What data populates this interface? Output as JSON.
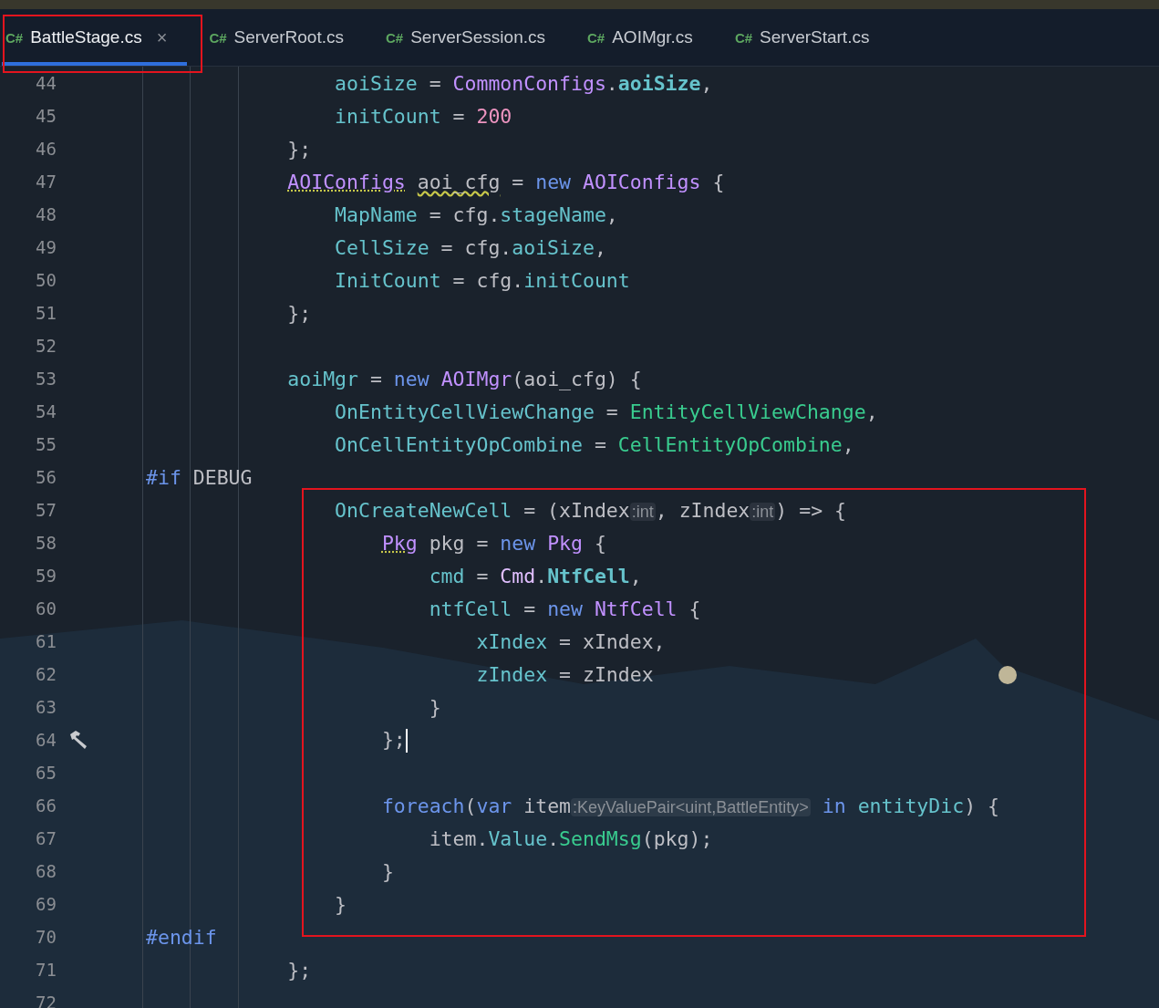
{
  "tabs": [
    {
      "icon": "C#",
      "label": "BattleStage.cs",
      "selected": true,
      "close": "×"
    },
    {
      "icon": "C#",
      "label": "ServerRoot.cs",
      "selected": false
    },
    {
      "icon": "C#",
      "label": "ServerSession.cs",
      "selected": false
    },
    {
      "icon": "C#",
      "label": "AOIMgr.cs",
      "selected": false
    },
    {
      "icon": "C#",
      "label": "ServerStart.cs",
      "selected": false
    }
  ],
  "editor": {
    "lines": [
      {
        "number": "44",
        "tokens": [
          {
            "t": "                aoiSize",
            "kind": "field"
          },
          {
            "t": " = ",
            "kind": "plain"
          },
          {
            "t": "CommonConfigs",
            "kind": "type"
          },
          {
            "t": ".",
            "kind": "plain"
          },
          {
            "t": "aoiSize",
            "kind": "static"
          },
          {
            "t": ",",
            "kind": "plain"
          }
        ]
      },
      {
        "number": "45",
        "tokens": [
          {
            "t": "                initCount",
            "kind": "field"
          },
          {
            "t": " = ",
            "kind": "plain"
          },
          {
            "t": "200",
            "kind": "number"
          }
        ]
      },
      {
        "number": "46",
        "tokens": [
          {
            "t": "            };",
            "kind": "plain"
          }
        ]
      },
      {
        "number": "47",
        "tokens": [
          {
            "t": "            AOIConfigs",
            "kind": "type",
            "suggestion": true
          },
          {
            "t": " aoi_cfg",
            "kind": "plain",
            "warning": true
          },
          {
            "t": " = ",
            "kind": "plain"
          },
          {
            "t": "new",
            "kind": "keyword"
          },
          {
            "t": " AOIConfigs",
            "kind": "type"
          },
          {
            "t": " {",
            "kind": "plain"
          }
        ]
      },
      {
        "number": "48",
        "tokens": [
          {
            "t": "                MapName",
            "kind": "field"
          },
          {
            "t": " = cfg.",
            "kind": "plain"
          },
          {
            "t": "stageName",
            "kind": "field"
          },
          {
            "t": ",",
            "kind": "plain"
          }
        ]
      },
      {
        "number": "49",
        "tokens": [
          {
            "t": "                CellSize",
            "kind": "field"
          },
          {
            "t": " = cfg.",
            "kind": "plain"
          },
          {
            "t": "aoiSize",
            "kind": "field"
          },
          {
            "t": ",",
            "kind": "plain"
          }
        ]
      },
      {
        "number": "50",
        "tokens": [
          {
            "t": "                InitCount",
            "kind": "field"
          },
          {
            "t": " = cfg.",
            "kind": "plain"
          },
          {
            "t": "initCount",
            "kind": "field"
          }
        ]
      },
      {
        "number": "51",
        "tokens": [
          {
            "t": "            };",
            "kind": "plain"
          }
        ]
      },
      {
        "number": "52"
      },
      {
        "number": "53",
        "tokens": [
          {
            "t": "            aoiMgr",
            "kind": "field"
          },
          {
            "t": " = ",
            "kind": "plain"
          },
          {
            "t": "new",
            "kind": "keyword"
          },
          {
            "t": " AOIMgr",
            "kind": "type"
          },
          {
            "t": "(aoi_cfg) {",
            "kind": "plain"
          }
        ]
      },
      {
        "number": "54",
        "tokens": [
          {
            "t": "                OnEntityCellViewChange",
            "kind": "field"
          },
          {
            "t": " = ",
            "kind": "plain"
          },
          {
            "t": "EntityCellViewChange",
            "kind": "method"
          },
          {
            "t": ",",
            "kind": "plain"
          }
        ]
      },
      {
        "number": "55",
        "tokens": [
          {
            "t": "                OnCellEntityOpCombine",
            "kind": "field"
          },
          {
            "t": " = ",
            "kind": "plain"
          },
          {
            "t": "CellEntityOpCombine",
            "kind": "method"
          },
          {
            "t": ",",
            "kind": "plain"
          }
        ]
      },
      {
        "number": "56",
        "tokens": [
          {
            "t": "#if",
            "kind": "keyword"
          },
          {
            "t": " DEBUG",
            "kind": "plain"
          }
        ]
      },
      {
        "number": "57",
        "tokens": [
          {
            "t": "                OnCreateNewCell",
            "kind": "field"
          },
          {
            "t": " = (xIndex",
            "kind": "plain"
          },
          {
            "t": ":int",
            "kind": "hint"
          },
          {
            "t": ", zIndex",
            "kind": "plain"
          },
          {
            "t": ":int",
            "kind": "hint"
          },
          {
            "t": ") => {",
            "kind": "plain"
          }
        ]
      },
      {
        "number": "58",
        "tokens": [
          {
            "t": "                    Pkg",
            "kind": "type",
            "suggestion": true
          },
          {
            "t": " pkg = ",
            "kind": "plain"
          },
          {
            "t": "new",
            "kind": "keyword"
          },
          {
            "t": " Pkg",
            "kind": "type"
          },
          {
            "t": " {",
            "kind": "plain"
          }
        ]
      },
      {
        "number": "59",
        "tokens": [
          {
            "t": "                        cmd",
            "kind": "field"
          },
          {
            "t": " = ",
            "kind": "plain"
          },
          {
            "t": "Cmd",
            "kind": "enum"
          },
          {
            "t": ".",
            "kind": "plain"
          },
          {
            "t": "NtfCell",
            "kind": "static"
          },
          {
            "t": ",",
            "kind": "plain"
          }
        ]
      },
      {
        "number": "60",
        "tokens": [
          {
            "t": "                        ntfCell",
            "kind": "field"
          },
          {
            "t": " = ",
            "kind": "plain"
          },
          {
            "t": "new",
            "kind": "keyword"
          },
          {
            "t": " NtfCell",
            "kind": "type"
          },
          {
            "t": " {",
            "kind": "plain"
          }
        ]
      },
      {
        "number": "61",
        "tokens": [
          {
            "t": "                            xIndex",
            "kind": "field"
          },
          {
            "t": " = xIndex,",
            "kind": "plain"
          }
        ]
      },
      {
        "number": "62",
        "tokens": [
          {
            "t": "                            zIndex",
            "kind": "field"
          },
          {
            "t": " = zIndex",
            "kind": "plain"
          }
        ]
      },
      {
        "number": "63",
        "tokens": [
          {
            "t": "                        }",
            "kind": "plain"
          }
        ]
      },
      {
        "number": "64",
        "build_marker": true,
        "caret": true,
        "tokens": [
          {
            "t": "                    };",
            "kind": "plain"
          }
        ]
      },
      {
        "number": "65"
      },
      {
        "number": "66",
        "tokens": [
          {
            "t": "                    foreach",
            "kind": "keyword"
          },
          {
            "t": "(",
            "kind": "plain"
          },
          {
            "t": "var",
            "kind": "keyword"
          },
          {
            "t": " item",
            "kind": "plain"
          },
          {
            "t": ":KeyValuePair<uint,BattleEntity>",
            "kind": "hint"
          },
          {
            "t": " in",
            "kind": "keyword"
          },
          {
            "t": " entityDic",
            "kind": "field"
          },
          {
            "t": ") {",
            "kind": "plain"
          }
        ]
      },
      {
        "number": "67",
        "tokens": [
          {
            "t": "                        item.",
            "kind": "plain"
          },
          {
            "t": "Value",
            "kind": "field"
          },
          {
            "t": ".",
            "kind": "plain"
          },
          {
            "t": "SendMsg",
            "kind": "method"
          },
          {
            "t": "(pkg);",
            "kind": "plain"
          }
        ]
      },
      {
        "number": "68",
        "tokens": [
          {
            "t": "                    }",
            "kind": "plain"
          }
        ]
      },
      {
        "number": "69",
        "tokens": [
          {
            "t": "                }",
            "kind": "plain"
          }
        ]
      },
      {
        "number": "70",
        "tokens": [
          {
            "t": "#endif",
            "kind": "keyword"
          }
        ]
      },
      {
        "number": "71",
        "tokens": [
          {
            "t": "            };",
            "kind": "plain"
          }
        ]
      },
      {
        "number": "72"
      }
    ]
  }
}
